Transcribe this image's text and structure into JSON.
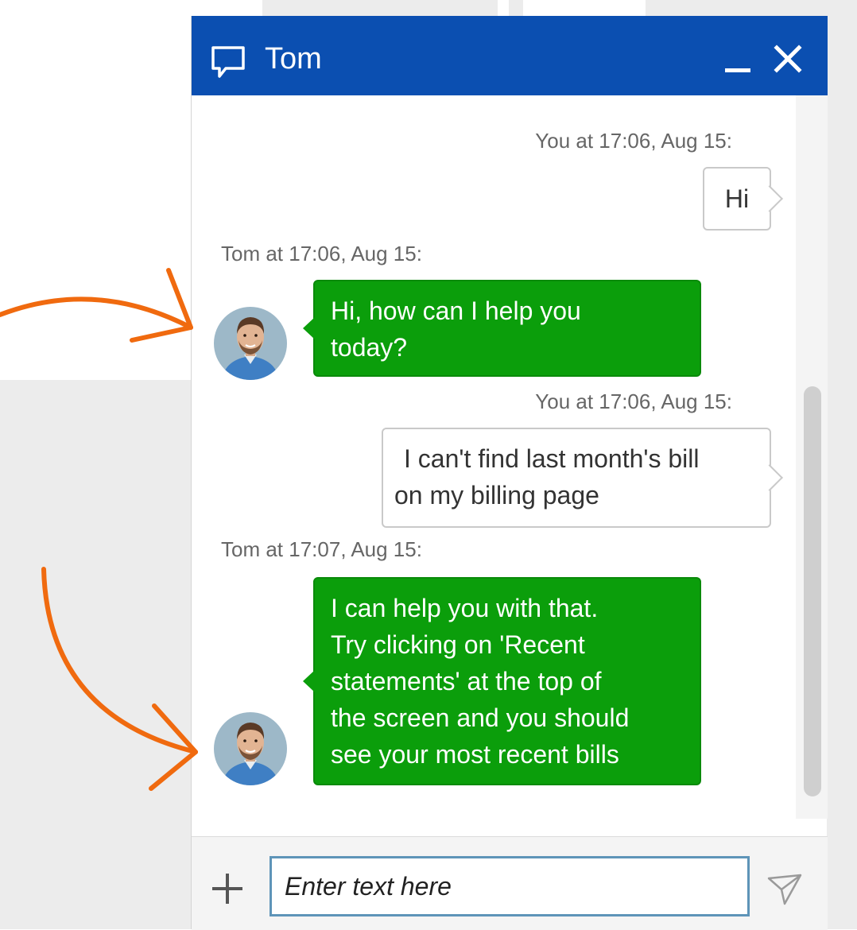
{
  "window": {
    "title": "Tom"
  },
  "messages": [
    {
      "sender": "You",
      "meta": "You at 17:06, Aug 15:",
      "text": "Hi",
      "direction": "out"
    },
    {
      "sender": "Tom",
      "meta": "Tom at 17:06, Aug 15:",
      "lines": [
        "Hi, how can I help you",
        "today?"
      ],
      "direction": "in"
    },
    {
      "sender": "You",
      "meta": "You at 17:06, Aug 15:",
      "lines": [
        "I can't find last month's bill",
        "on my billing page"
      ],
      "direction": "out"
    },
    {
      "sender": "Tom",
      "meta": "Tom at 17:07, Aug 15:",
      "lines": [
        "I can help you with that.",
        "Try clicking on 'Recent",
        "statements' at the top of",
        "the screen and you should",
        "see your most recent bills"
      ],
      "direction": "in"
    }
  ],
  "composer": {
    "placeholder": "Enter text here"
  },
  "icons": {
    "title": "chat-bubble-icon",
    "minimize": "minimize-icon",
    "close": "close-icon",
    "add": "plus-icon",
    "send": "send-icon",
    "annotation": "orange-arrow"
  },
  "colors": {
    "titlebar": "#0b4fb1",
    "agent_bubble": "#0b9e0b",
    "annotation_arrow": "#f06a0f",
    "input_border": "#5e94b8"
  }
}
